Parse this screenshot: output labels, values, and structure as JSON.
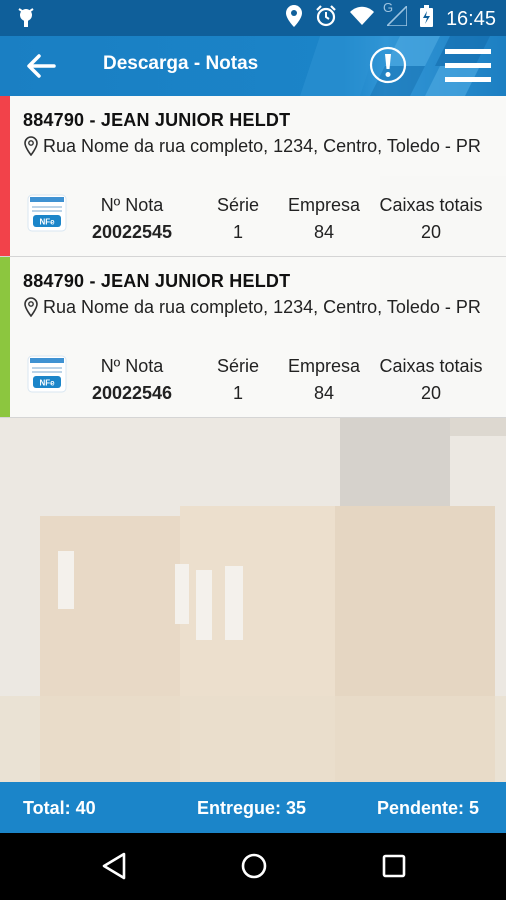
{
  "status_bar": {
    "time": "16:45",
    "network_letter": "G"
  },
  "app_bar": {
    "title": "Descarga - Notas"
  },
  "column_labels": {
    "nota": "Nº Nota",
    "serie": "Série",
    "empresa": "Empresa",
    "caixas": "Caixas totais"
  },
  "cards": [
    {
      "client": "884790 - JEAN JUNIOR HELDT",
      "address": "Rua Nome da rua completo, 1234, Centro, Toledo - PR",
      "badge": "NFe",
      "nota": "20022545",
      "serie": "1",
      "empresa": "84",
      "caixas": "20",
      "status_color": "#f2424a"
    },
    {
      "client": "884790 - JEAN JUNIOR HELDT",
      "address": "Rua Nome da rua completo, 1234, Centro, Toledo - PR",
      "badge": "NFe",
      "nota": "20022546",
      "serie": "1",
      "empresa": "84",
      "caixas": "20",
      "status_color": "#8cc63f"
    }
  ],
  "footer": {
    "total": "Total: 40",
    "entregue": "Entregue: 35",
    "pendente": "Pendente: 5"
  },
  "colors": {
    "primary": "#1b85c9",
    "status_bar": "#0f5f9a"
  }
}
